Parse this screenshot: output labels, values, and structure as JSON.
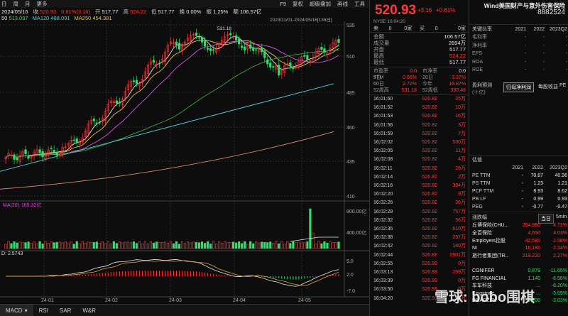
{
  "toolbar": {
    "items": [
      "日",
      "周",
      "月",
      "更多"
    ],
    "right_items": [
      "F9",
      "复权",
      "超级叠加",
      "画线",
      "工具"
    ]
  },
  "infoline": {
    "date": "2024/05/16",
    "close_label": "收",
    "close": "520.93",
    "pct": "0.61%(3.16)",
    "open_label": "开",
    "open": "517.77",
    "high_label": "高",
    "high": "524.22",
    "low_label": "低",
    "low": "517.77",
    "turnover_label": "换",
    "turnover": "0.00%",
    "amplitude_label": "振",
    "amplitude": "1.25%",
    "amount_label": "额",
    "amount": "106.57亿"
  },
  "maline": {
    "ma_a": "50",
    "ma_a_val": "513.097",
    "ma120_label": "MA120",
    "ma120": "488.091",
    "ma250_label": "MA250",
    "ma250": "454.381"
  },
  "range_label": "2023/11/01-2024/05/16[136日]",
  "price_axis": [
    "535",
    "510",
    "485",
    "460",
    "435",
    "410"
  ],
  "peak_label": "531.18",
  "volume": {
    "label": "MA(20):",
    "value": "165.32亿",
    "axis": [
      "800.00亿",
      "400.00亿"
    ]
  },
  "macd": {
    "label": "D: 2.5743",
    "axis": [
      "9.0",
      "2.0",
      "-7.0"
    ]
  },
  "date_axis": [
    "24-01",
    "24-02",
    "24-03",
    "24-04",
    "24-05"
  ],
  "tabs": [
    "MACD",
    "RSI",
    "SAR",
    "W&R"
  ],
  "colors": {
    "up": "#ff3a3a",
    "down": "#2ee06a",
    "ma_short": "#e8e8e8",
    "ma_mid": "#e8c53a",
    "ma_long": "#e04ee0",
    "ma60": "#3aa53a",
    "ma120": "#55d0e0",
    "ma250": "#e08a7a"
  },
  "quote": {
    "price": "520.93",
    "change": "+3.16",
    "pct": "+0.61%",
    "exchange_time": "NYSE 16:04:20",
    "bidask": [
      {
        "label": "卖",
        "val1": "0",
        "label2": "0家",
        "label3": "买",
        "val2": "0",
        "label4": "0家"
      }
    ],
    "fields": [
      {
        "k": "金额",
        "v": "106.57亿"
      },
      {
        "k": "成交量",
        "v": "2694万"
      },
      {
        "k": "开盘",
        "v": "517.77"
      },
      {
        "k": "最高",
        "v": "524.22"
      },
      {
        "k": "最低",
        "v": "517.77"
      }
    ],
    "stats": [
      {
        "a": "市盈率TTM",
        "b": "0.0",
        "c": "市净率",
        "d": "0.0"
      },
      {
        "a": "5日",
        "b": "0.66%",
        "c": "20日",
        "d": "3.37%"
      },
      {
        "a": "60日",
        "b": "2.72%",
        "c": "今年",
        "d": "16.87%"
      },
      {
        "a": "52周高",
        "b": "531.18",
        "c": "52周低",
        "d": "390.48"
      }
    ],
    "ticks": [
      {
        "t": "16:01:50",
        "p": "520.82",
        "v": "25万"
      },
      {
        "t": "16:01:52",
        "p": "520.82",
        "v": "10万"
      },
      {
        "t": "16:01:53",
        "p": "520.82",
        "v": "16万"
      },
      {
        "t": "16:01:56",
        "p": "520.82",
        "v": "3万"
      },
      {
        "t": "16:01:59",
        "p": "520.82",
        "v": "7万"
      },
      {
        "t": "16:02:02",
        "p": "520.82",
        "v": "530万"
      },
      {
        "t": "16:02:05",
        "p": "520.82",
        "v": "11万"
      },
      {
        "t": "16:02:08",
        "p": "520.82",
        "v": "4万"
      },
      {
        "t": "16:02:11",
        "p": "520.82",
        "v": "28万"
      },
      {
        "t": "16:02:14",
        "p": "520.82",
        "v": "2万"
      },
      {
        "t": "16:02:16",
        "p": "520.82",
        "v": "394万"
      },
      {
        "t": "16:02:20",
        "p": "520.82",
        "v": "9万"
      },
      {
        "t": "16:02:26",
        "p": "520.82",
        "v": "36万"
      },
      {
        "t": "16:02:29",
        "p": "520.82",
        "v": "757万"
      },
      {
        "t": "16:02:32",
        "p": "520.82",
        "v": "36万"
      },
      {
        "t": "16:02:35",
        "p": "520.82",
        "v": "610万"
      },
      {
        "t": "16:02:38",
        "p": "520.82",
        "v": "257万"
      },
      {
        "t": "16:02:42",
        "p": "520.82",
        "v": "140万"
      },
      {
        "t": "16:02:44",
        "p": "520.82",
        "v": "2901万"
      },
      {
        "t": "16:02:55",
        "p": "520.93",
        "v": "0万"
      },
      {
        "t": "16:03:13",
        "p": "520.93",
        "v": "259万"
      },
      {
        "t": "16:03:39",
        "p": "520.93",
        "v": "0万"
      },
      {
        "t": "16:03:50",
        "p": "520.93",
        "v": "0万"
      },
      {
        "t": "16:04:20",
        "p": "520.93",
        "v": "14万"
      }
    ]
  },
  "info": {
    "name": "Wind美国财产与意外伤害保险",
    "code": "8882524",
    "fin_title": "关键比率",
    "fin_cols": [
      "2021",
      "2022",
      "2023Q2"
    ],
    "fin_rows": [
      {
        "k": "毛利率",
        "v": [
          "-",
          "-",
          "-"
        ]
      },
      {
        "k": "净利率",
        "v": [
          "-",
          "-",
          "-"
        ]
      },
      {
        "k": "EPS",
        "v": [
          "-",
          "-",
          "-"
        ]
      },
      {
        "k": "ROA",
        "v": [
          "-",
          "-",
          "-"
        ]
      },
      {
        "k": "ROE",
        "v": [
          "-",
          "-",
          "-"
        ]
      }
    ],
    "profit_title": "盈利预测",
    "profit_unit": "(十亿)",
    "profit_tabs": [
      "归母净利润",
      "每股收益",
      "PE"
    ],
    "val_title": "估值",
    "val_cols": [
      "2021",
      "2022",
      "2023Q2"
    ],
    "val_rows": [
      {
        "k": "PE TTM",
        "v": [
          "-",
          "70.87",
          "40.96"
        ]
      },
      {
        "k": "PS TTM",
        "v": [
          "-",
          "1.23",
          "1.21"
        ]
      },
      {
        "k": "PCF TTM",
        "v": [
          "-",
          "8.93",
          "8.62"
        ]
      },
      {
        "k": "PB LF",
        "v": [
          "-",
          "0.99",
          "0.93"
        ]
      },
      {
        "k": "PEG",
        "v": [
          "-",
          "-0.77",
          "-0.47"
        ]
      }
    ],
    "movers_title": "涨跌幅",
    "movers_tabs": [
      "当日",
      "5min"
    ],
    "movers": [
      {
        "n": "丘博保险(CHU...",
        "p": "264.880",
        "c": "4.71%",
        "dir": "up"
      },
      {
        "n": "全百保险",
        "p": "4.650",
        "c": "4.03%",
        "dir": "up"
      },
      {
        "n": "Employers控股",
        "p": "42.580",
        "c": "2.58%",
        "dir": "up"
      },
      {
        "n": "NI",
        "p": "16.180",
        "c": "2.34%",
        "dir": "up"
      },
      {
        "n": "旅行者集团(TR...",
        "p": "219.220",
        "c": "2.27%",
        "dir": "up"
      },
      {
        "n": "CONIFER",
        "p": "0.879",
        "c": "-11.65%",
        "dir": "down"
      },
      {
        "n": "FG FINANCIAL",
        "p": "1.140",
        "c": "-6.56%",
        "dir": "down"
      },
      {
        "n": "车车科技",
        "p": "...",
        "c": "-6.20%",
        "dir": "down"
      },
      {
        "n": "Kingstone",
        "p": "...",
        "c": "-3.59%",
        "dir": "down"
      },
      {
        "n": "ROADZEN",
        "p": "3.200",
        "c": "-3.03%",
        "dir": "down"
      }
    ]
  },
  "watermark": "雪球: bobo围棋"
}
